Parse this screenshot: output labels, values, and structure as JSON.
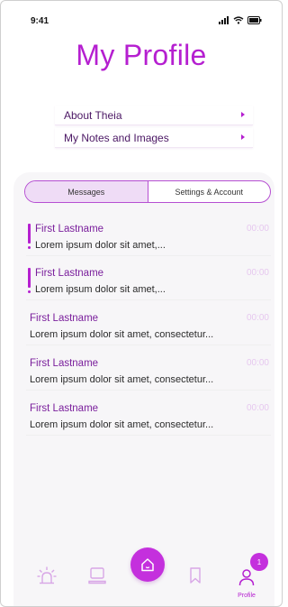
{
  "status_bar": {
    "time": "9:41"
  },
  "header": {
    "title": "My Profile"
  },
  "menu": [
    {
      "label": "About Theia"
    },
    {
      "label": "My Notes and Images"
    }
  ],
  "tabs": [
    {
      "label": "Messages",
      "active": true
    },
    {
      "label": "Settings & Account",
      "active": false
    }
  ],
  "messages": [
    {
      "name": "First Lastname",
      "preview": "Lorem ipsum dolor sit amet,...",
      "time": "00:00",
      "unread": true
    },
    {
      "name": "First Lastname",
      "preview": "Lorem ipsum dolor sit amet,...",
      "time": "00:00",
      "unread": true
    },
    {
      "name": "First Lastname",
      "preview": "Lorem ipsum dolor sit amet, consectetur...",
      "time": "00:00",
      "unread": false
    },
    {
      "name": "First Lastname",
      "preview": "Lorem ipsum dolor sit amet, consectetur...",
      "time": "00:00",
      "unread": false
    },
    {
      "name": "First Lastname",
      "preview": "Lorem ipsum dolor sit amet, consectetur...",
      "time": "00:00",
      "unread": false
    }
  ],
  "bottom_nav": {
    "items": [
      {
        "icon": "alert-light-icon"
      },
      {
        "icon": "laptop-icon"
      },
      {
        "icon": "home-icon"
      },
      {
        "icon": "bookmark-icon"
      },
      {
        "icon": "profile-icon",
        "label": "Profile",
        "badge": "1"
      }
    ]
  },
  "colors": {
    "accent": "#c430dd",
    "accent_light": "#efdcf6",
    "text_dark": "#4b1764"
  }
}
